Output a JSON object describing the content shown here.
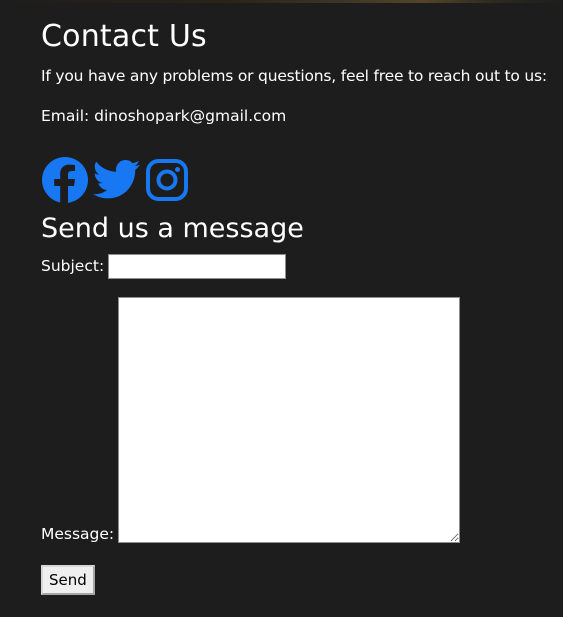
{
  "page": {
    "heading": "Contact Us",
    "intro": "If you have any problems or questions, feel free to reach out to us:",
    "email_text": "Email: dinoshopark@gmail.com"
  },
  "social": {
    "icons": [
      "facebook-icon",
      "twitter-icon",
      "instagram-icon"
    ],
    "color": "#1877f2"
  },
  "form": {
    "heading": "Send us a message",
    "subject_label": "Subject:",
    "subject_value": "",
    "message_label": "Message:",
    "message_value": "",
    "send_label": "Send"
  },
  "colors": {
    "background": "#1d1d1d",
    "text": "#ffffff"
  }
}
